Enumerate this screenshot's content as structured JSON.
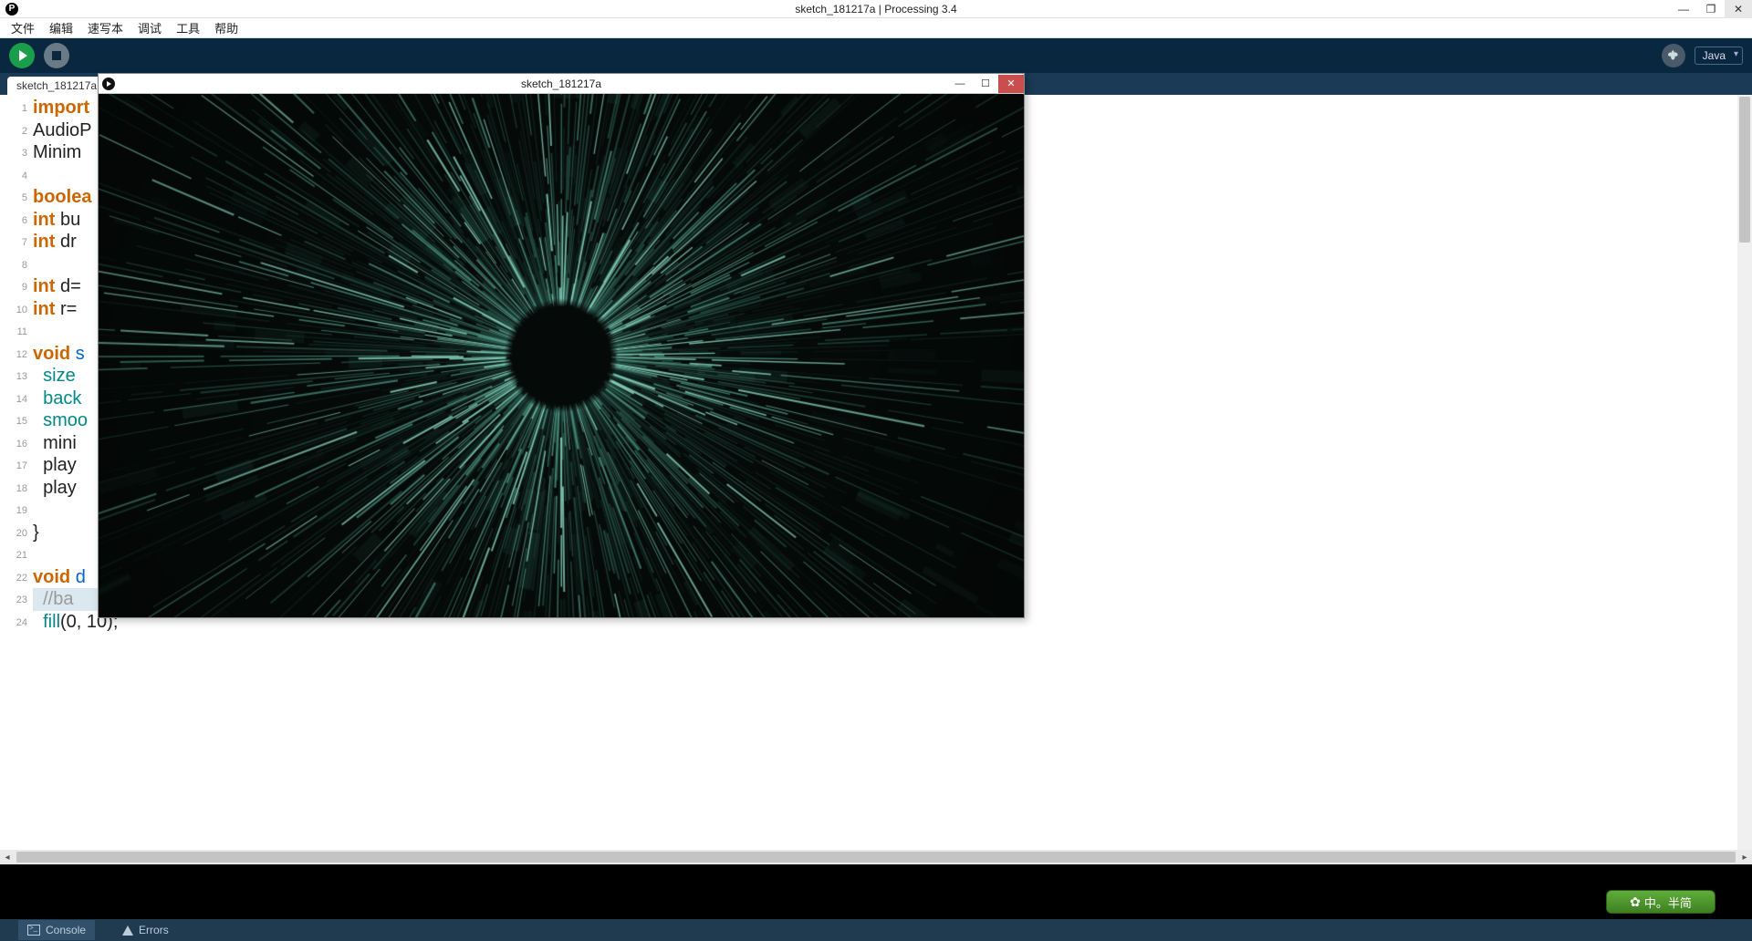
{
  "os": {
    "title": "sketch_181217a | Processing 3.4",
    "min_icon": "—",
    "max_icon": "❐",
    "close_icon": "✕"
  },
  "menu": {
    "items": [
      "文件",
      "编辑",
      "速写本",
      "调试",
      "工具",
      "帮助"
    ]
  },
  "toolbar": {
    "mode_label": "Java"
  },
  "tabs": {
    "active": "sketch_181217a"
  },
  "code": {
    "lines": [
      {
        "tokens": [
          [
            "kw-orange",
            "import"
          ]
        ]
      },
      {
        "tokens": [
          [
            "plain",
            "AudioP"
          ]
        ]
      },
      {
        "tokens": [
          [
            "plain",
            "Minim "
          ]
        ]
      },
      {
        "tokens": []
      },
      {
        "tokens": [
          [
            "kw-orange",
            "boolea"
          ]
        ]
      },
      {
        "tokens": [
          [
            "kw-orange",
            "int"
          ],
          [
            "plain",
            " bu"
          ]
        ]
      },
      {
        "tokens": [
          [
            "kw-orange",
            "int"
          ],
          [
            "plain",
            " dr"
          ]
        ]
      },
      {
        "tokens": []
      },
      {
        "tokens": [
          [
            "kw-orange",
            "int"
          ],
          [
            "plain",
            " d="
          ]
        ]
      },
      {
        "tokens": [
          [
            "kw-orange",
            "int"
          ],
          [
            "plain",
            " r="
          ]
        ]
      },
      {
        "tokens": []
      },
      {
        "tokens": [
          [
            "kw-orange",
            "void"
          ],
          [
            "plain",
            " "
          ],
          [
            "kw-blue",
            "s"
          ]
        ]
      },
      {
        "tokens": [
          [
            "plain",
            "  "
          ],
          [
            "kw-teal",
            "size"
          ]
        ]
      },
      {
        "tokens": [
          [
            "plain",
            "  "
          ],
          [
            "kw-teal",
            "back"
          ]
        ]
      },
      {
        "tokens": [
          [
            "plain",
            "  "
          ],
          [
            "kw-teal",
            "smoo"
          ]
        ]
      },
      {
        "tokens": [
          [
            "plain",
            "  mini"
          ]
        ]
      },
      {
        "tokens": [
          [
            "plain",
            "  play"
          ]
        ]
      },
      {
        "tokens": [
          [
            "plain",
            "  play"
          ]
        ]
      },
      {
        "tokens": []
      },
      {
        "tokens": [
          [
            "plain",
            "}"
          ]
        ]
      },
      {
        "tokens": []
      },
      {
        "tokens": [
          [
            "kw-orange",
            "void"
          ],
          [
            "plain",
            " "
          ],
          [
            "kw-blue",
            "d"
          ]
        ]
      },
      {
        "hl": true,
        "tokens": [
          [
            "plain",
            "  "
          ],
          [
            "comment",
            "//ba"
          ]
        ]
      },
      {
        "tokens": [
          [
            "plain",
            "  "
          ],
          [
            "kw-teal",
            "fill"
          ],
          [
            "plain",
            "(0, 10);"
          ]
        ]
      }
    ]
  },
  "console": {
    "text": ""
  },
  "statusbar": {
    "console_label": "Console",
    "errors_label": "Errors"
  },
  "ime": {
    "label": "中。半简"
  },
  "sketch_window": {
    "title": "sketch_181217a",
    "min_icon": "—",
    "max_icon": "☐",
    "close_icon": "✕"
  },
  "visual": {
    "accent_green": "#3a7a6a",
    "bright_green": "#5fb89f",
    "bg_dark": "#060c0a"
  }
}
